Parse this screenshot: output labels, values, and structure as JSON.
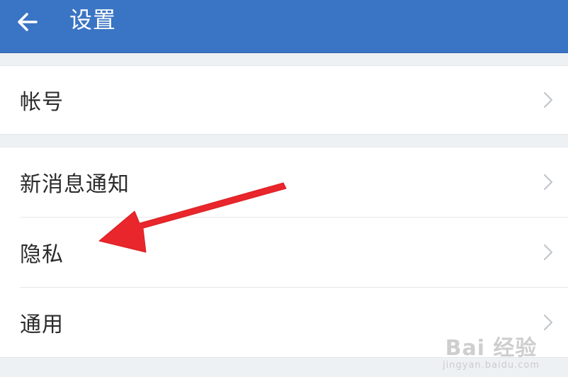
{
  "header": {
    "title": "设置",
    "back_icon": "arrow-left-icon"
  },
  "settings": {
    "group1": [
      {
        "label": "帐号",
        "icon": "chevron-right-icon"
      }
    ],
    "group2": [
      {
        "label": "新消息通知",
        "icon": "chevron-right-icon"
      },
      {
        "label": "隐私",
        "icon": "chevron-right-icon"
      },
      {
        "label": "通用",
        "icon": "chevron-right-icon"
      }
    ]
  },
  "annotation": {
    "arrow_color": "#e8262b"
  },
  "watermark": {
    "line1": "Bai 经验",
    "line2": "jingyan.baidu.com"
  },
  "colors": {
    "header_bg": "#3a74c4",
    "page_bg": "#eef1f4",
    "row_bg": "#ffffff",
    "text": "#2b2b2b",
    "chevron": "#c2c6cc"
  }
}
